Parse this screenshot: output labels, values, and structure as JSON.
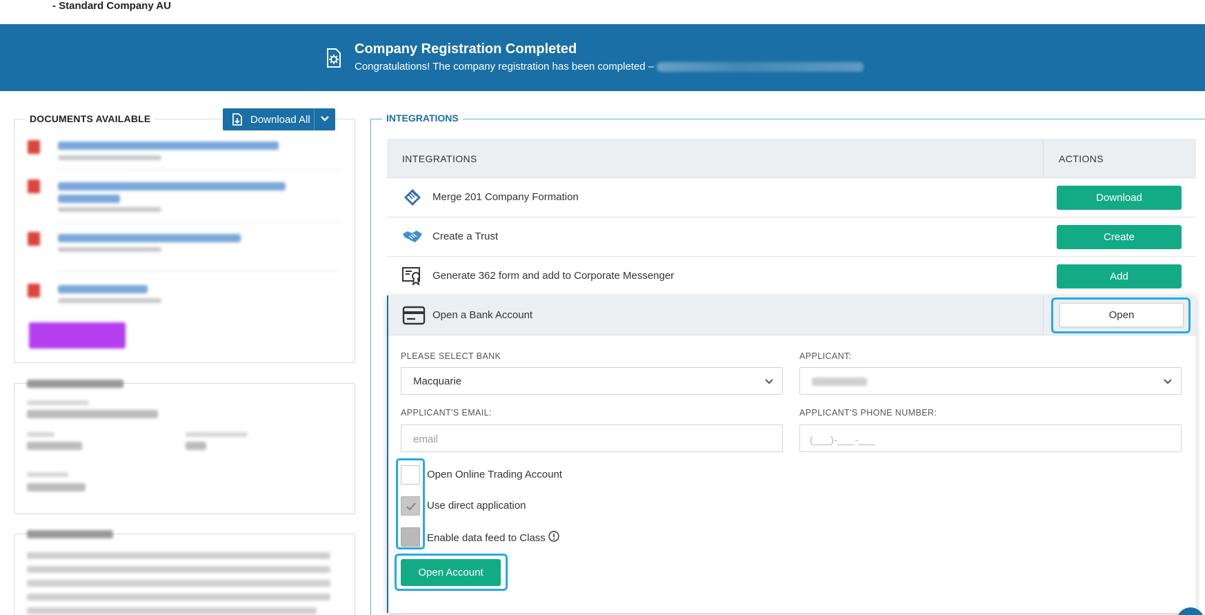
{
  "header": {
    "company_type": "- Standard Company AU"
  },
  "banner": {
    "title": "Company Registration Completed",
    "subtitle": "Congratulations! The company registration has been completed –",
    "icon": "document-gear-icon"
  },
  "documents": {
    "legend": "DOCUMENTS AVAILABLE",
    "download_all_label": "Download All"
  },
  "integrations": {
    "legend": "INTEGRATIONS",
    "col_integrations": "INTEGRATIONS",
    "col_actions": "ACTIONS",
    "rows": [
      {
        "label": "Merge 201 Company Formation",
        "action": "Download",
        "icon": "merge-logo-icon"
      },
      {
        "label": "Create a Trust",
        "action": "Create",
        "icon": "handshake-icon"
      },
      {
        "label": "Generate 362 form and add to Corporate Messenger",
        "action": "Add",
        "icon": "certificate-icon"
      }
    ],
    "bank": {
      "label": "Open a Bank Account",
      "action": "Open",
      "icon": "credit-card-icon",
      "select_bank_label": "PLEASE SELECT BANK",
      "select_bank_value": "Macquarie",
      "applicant_label": "APPLICANT:",
      "email_label": "APPLICANT'S EMAIL:",
      "email_placeholder": "email",
      "phone_label": "APPLICANT'S PHONE NUMBER:",
      "phone_placeholder": "(___)-___-___",
      "options": [
        {
          "label": "Open Online Trading Account",
          "checked": false
        },
        {
          "label": "Use direct application",
          "checked": true
        },
        {
          "label": "Enable data feed to Class",
          "checked": false
        }
      ],
      "submit_label": "Open Account"
    }
  },
  "colors": {
    "brand_blue": "#1a6fa6",
    "action_green": "#13ab85",
    "highlight_blue": "#27a9e1"
  }
}
